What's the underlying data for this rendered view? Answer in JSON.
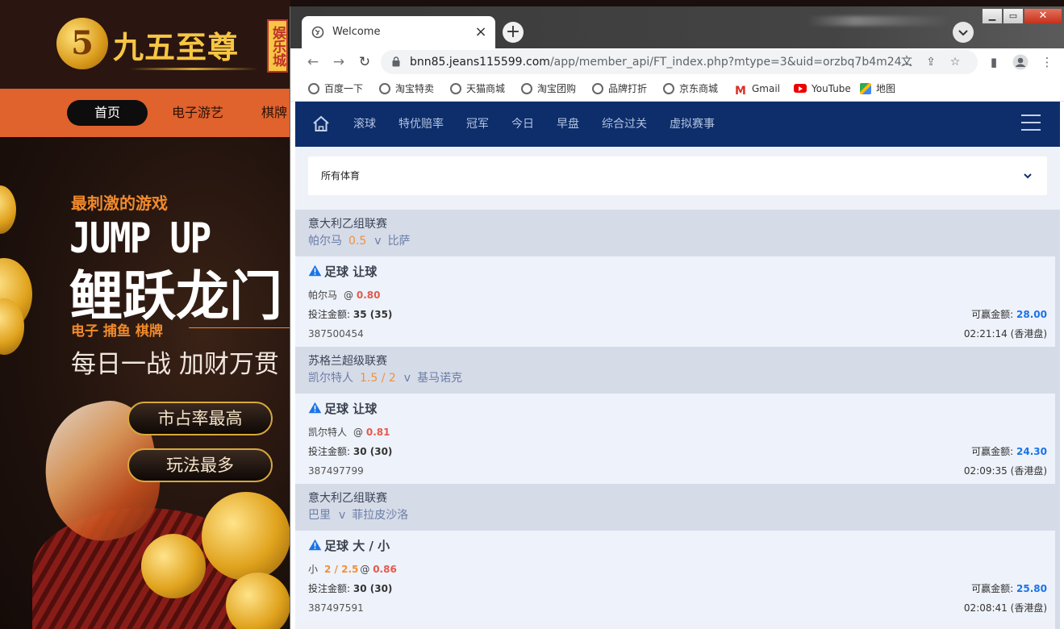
{
  "background_site": {
    "logo_text": "九五至尊",
    "logo_badge": "娱乐城",
    "nav": {
      "home": "首页",
      "item_2": "电子游艺",
      "item_3": "棋牌"
    },
    "banner": {
      "subtitle": "最刺激的游戏",
      "headline": "JUMP UP",
      "title": "鲤跃龙门",
      "tags": "电子  捕鱼  棋牌",
      "slogan": "每日一战  加财万贯",
      "pill_1": "市占率最高",
      "pill_2": "玩法最多"
    }
  },
  "browser": {
    "tab_title": "Welcome",
    "url_host": "bnn85.jeans115599.com",
    "url_path": "/app/member_api/FT_index.php?mtype=3&uid=orzbq7b4m24...",
    "bookmarks": [
      {
        "label": "百度一下",
        "icon": "globe-icon"
      },
      {
        "label": "淘宝特卖",
        "icon": "globe-icon"
      },
      {
        "label": "天猫商城",
        "icon": "globe-icon"
      },
      {
        "label": "淘宝团购",
        "icon": "globe-icon"
      },
      {
        "label": "品牌打折",
        "icon": "globe-icon"
      },
      {
        "label": "京东商城",
        "icon": "globe-icon"
      },
      {
        "label": "Gmail",
        "icon": "gmail-icon"
      },
      {
        "label": "YouTube",
        "icon": "youtube-icon"
      },
      {
        "label": "地图",
        "icon": "maps-icon"
      }
    ]
  },
  "page": {
    "topnav": [
      "滚球",
      "特优赔率",
      "冠军",
      "今日",
      "早盘",
      "综合过关",
      "虚拟赛事"
    ],
    "sport_select": "所有体育",
    "bets": [
      {
        "league": "意大利乙组联赛",
        "home": "帕尔马",
        "handicap": "0.5",
        "vs": "v",
        "away": "比萨",
        "type": "足球 让球",
        "selection": "帕尔马",
        "sel_line": "",
        "at": "@",
        "odds": "0.80",
        "stake_label": "投注金额:",
        "stake": "35 (35)",
        "win_label": "可赢金额:",
        "win": "28.00",
        "id": "387500454",
        "time": "02:21:14 (香港盘)"
      },
      {
        "league": "苏格兰超级联赛",
        "home": "凯尔特人",
        "handicap": "1.5 / 2",
        "vs": "v",
        "away": "基马诺克",
        "type": "足球 让球",
        "selection": "凯尔特人",
        "sel_line": "",
        "at": "@",
        "odds": "0.81",
        "stake_label": "投注金额:",
        "stake": "30 (30)",
        "win_label": "可赢金额:",
        "win": "24.30",
        "id": "387497799",
        "time": "02:09:35 (香港盘)"
      },
      {
        "league": "意大利乙组联赛",
        "home": "巴里",
        "handicap": "",
        "vs": "v",
        "away": "菲拉皮沙洛",
        "type": "足球 大 / 小",
        "selection": "小",
        "sel_line": "2 / 2.5",
        "at": "@",
        "odds": "0.86",
        "stake_label": "投注金额:",
        "stake": "30 (30)",
        "win_label": "可赢金额:",
        "win": "25.80",
        "id": "387497591",
        "time": "02:08:41 (香港盘)"
      }
    ]
  },
  "colors": {
    "nav_bg": "#0d2e6b",
    "odds": "#e55a4b",
    "handicap": "#f0913a",
    "win": "#1a73e8",
    "warn": "#1a73e8"
  }
}
